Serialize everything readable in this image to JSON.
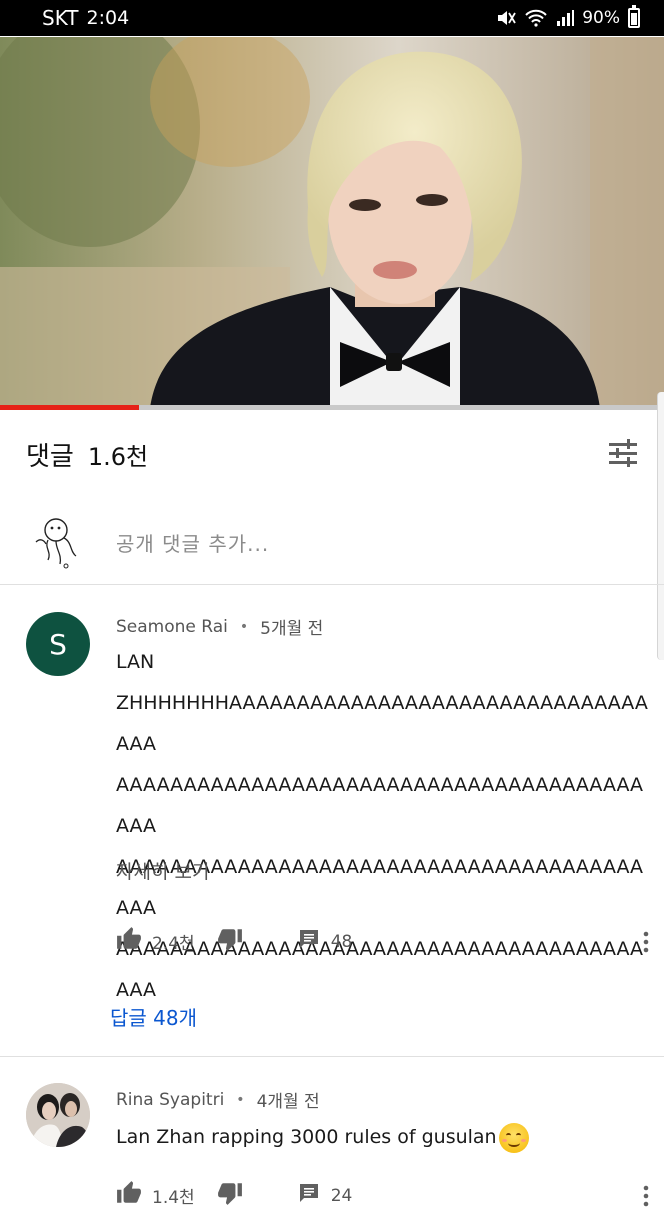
{
  "status_bar": {
    "carrier": "SKT",
    "time": "2:04",
    "battery": "90%"
  },
  "video": {
    "progress_fraction": 0.21
  },
  "comments_header": {
    "title": "댓글",
    "count": "1.6천"
  },
  "add_comment": {
    "placeholder": "공개 댓글 추가..."
  },
  "comments": [
    {
      "avatar_letter": "S",
      "author": "Seamone Rai",
      "age": "5개월 전",
      "text": "LAN ZHHHHHHHAAAAAAAAAAAAAAAAAAAAAAAAAAAAAAAAAAAAAAAAAAAAAAAAAAAAAAAAAAAAAAAAAAAAAAAAAAAAAAAAAAAAAAAAAAAAAAAAAAAAAAAAAAAAAAAAAAAAAAAAAAAAAAAAAAAAAAAAAAAAAAAAA",
      "text_line1": "LAN",
      "text_line2": "ZHHHHHHHAAAAAAAAAAAAAAAAAAAAAAAAAAAAAAAAAA",
      "text_line3": "AAAAAAAAAAAAAAAAAAAAAAAAAAAAAAAAAAAAAAAAAA",
      "text_line4": "AAAAAAAAAAAAAAAAAAAAAAAAAAAAAAAAAAAAAAAAAA",
      "text_line5": "AAAAAAAAAAAAAAAAAAAAAAAAAAAAAAAAAAAAAAAAAA",
      "read_more": "자세히 보기",
      "likes": "2.4천",
      "reply_count": "48",
      "replies_link": "답글 48개"
    },
    {
      "author": "Rina Syapitri",
      "age": "4개월 전",
      "text": "Lan Zhan rapping 3000 rules of gusulan",
      "likes": "1.4천",
      "reply_count": "24"
    }
  ],
  "icons": {
    "mute": "mute-icon",
    "wifi": "wifi-icon",
    "signal": "signal-icon",
    "battery": "battery-icon",
    "sort": "sort-filter-icon",
    "like": "thumbs-up-icon",
    "dislike": "thumbs-down-icon",
    "reply": "reply-comment-icon",
    "more": "more-vertical-icon",
    "emoji": "smiling-face-icon"
  },
  "colors": {
    "progress": "#e62117",
    "avatar_s": "#0e5240",
    "link": "#0b57d0"
  }
}
